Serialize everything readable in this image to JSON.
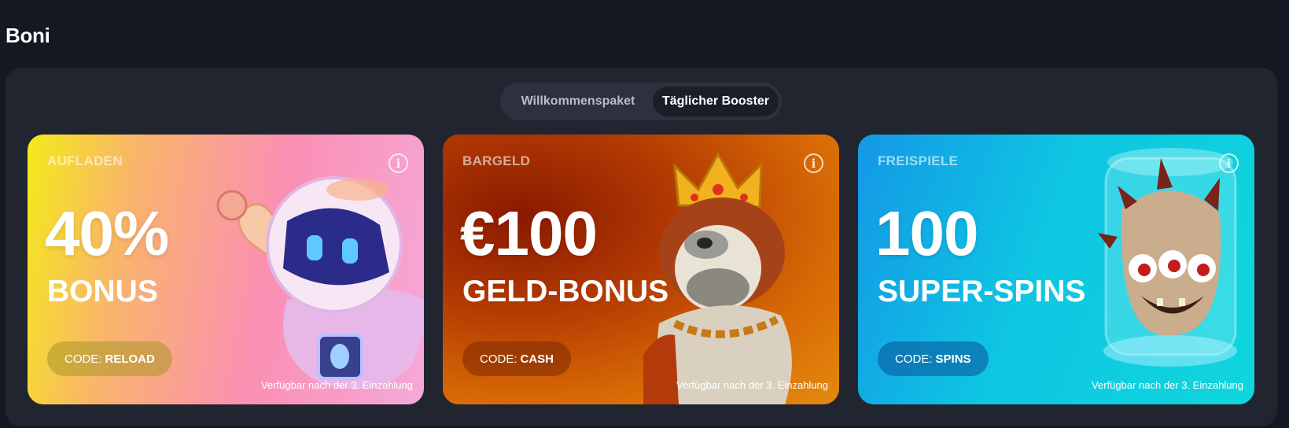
{
  "page": {
    "title": "Boni"
  },
  "tabs": [
    {
      "label": "Willkommenspaket",
      "active": false
    },
    {
      "label": "Täglicher Booster",
      "active": true
    }
  ],
  "cards": [
    {
      "kind": "AUFLADEN",
      "amount": "40%",
      "label": "BONUS",
      "code_prefix": "CODE:",
      "code": "RELOAD",
      "note": "Verfügbar nach der 3. Einzahlung",
      "illustration": "astronaut-robot",
      "accent": "#fb8fb4"
    },
    {
      "kind": "BARGELD",
      "amount": "€100",
      "label": "GELD-BONUS",
      "code_prefix": "CODE:",
      "code": "CASH",
      "note": "Verfügbar nach der 3. Einzahlung",
      "illustration": "bulldog-king",
      "accent": "#d86a05"
    },
    {
      "kind": "FREISPIELE",
      "amount": "100",
      "label": "SUPER-SPINS",
      "code_prefix": "CODE:",
      "code": "SPINS",
      "note": "Verfügbar nach der 3. Einzahlung",
      "illustration": "monster-in-jar",
      "accent": "#0ec6e2"
    }
  ],
  "icons": {
    "info": "i"
  }
}
